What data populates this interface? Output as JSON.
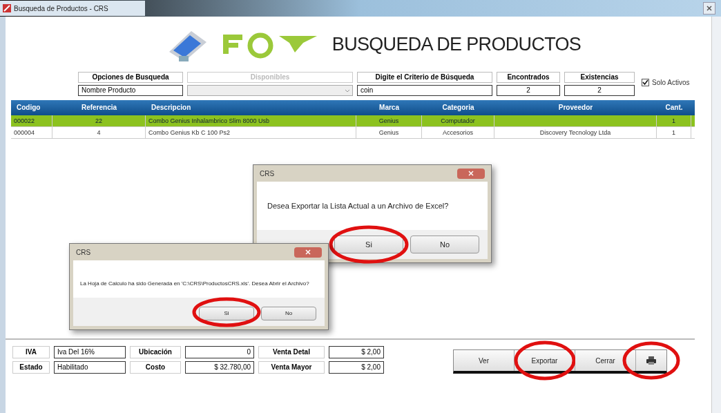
{
  "window": {
    "title": "Busqueda de Productos - CRS"
  },
  "header": {
    "title": "BUSQUEDA DE PRODUCTOS"
  },
  "search": {
    "options_label": "Opciones de Busqueda",
    "option_value": "Nombre Producto",
    "available_label": "Disponibles",
    "criteria_label": "Digite el Criterio de Búsqueda",
    "criteria_value": "coin",
    "found_label": "Encontrados",
    "found_value": "2",
    "stock_label": "Existencias",
    "stock_value": "2",
    "only_active": {
      "label": "Solo Activos",
      "checked": true
    }
  },
  "table": {
    "columns": [
      "Codigo",
      "Referencia",
      "Descripcion",
      "Marca",
      "Categoria",
      "Proveedor",
      "Cant."
    ],
    "rows": [
      {
        "selected": true,
        "cells": [
          "000022",
          "22",
          "Combo Genius Inhalambrico Slim 8000 Usb",
          "Genius",
          "Computador",
          "",
          "1"
        ]
      },
      {
        "selected": false,
        "cells": [
          "000004",
          "4",
          "Combo Genius Kb C 100 Ps2",
          "Genius",
          "Accesorios",
          "Discovery Tecnology Ltda",
          "1"
        ]
      }
    ]
  },
  "dialogs": [
    {
      "title": "CRS",
      "message": "Desea Exportar la Lista Actual a un Archivo de Excel?",
      "buttons": [
        {
          "label": "Si",
          "circled": true
        },
        {
          "label": "No",
          "circled": false
        }
      ]
    },
    {
      "title": "CRS",
      "message": "La Hoja de Calculo ha sido Generada en 'C:\\CRS\\ProductosCRS.xls'. Desea Abrir el Archivo?",
      "buttons": [
        {
          "label": "Si",
          "circled": true
        },
        {
          "label": "No",
          "circled": false
        }
      ]
    }
  ],
  "footer": {
    "fields": [
      {
        "label": "IVA",
        "value": "Iva Del 16%",
        "kind": "text"
      },
      {
        "label": "Ubicación",
        "value": "0",
        "kind": "number"
      },
      {
        "label": "Venta Detal",
        "value": "$ 2,00",
        "kind": "number"
      },
      {
        "label": "Estado",
        "value": "Habilitado",
        "kind": "text"
      },
      {
        "label": "Costo",
        "value": "$ 32.780,00",
        "kind": "number"
      },
      {
        "label": "Venta Mayor",
        "value": "$ 2,00",
        "kind": "number"
      }
    ]
  },
  "buttons": [
    {
      "kind": "text",
      "label": "Ver",
      "circled": false
    },
    {
      "kind": "text",
      "label": "Exportar",
      "circled": true
    },
    {
      "kind": "text",
      "label": "Cerrar",
      "circled": false
    },
    {
      "kind": "print",
      "circled": true
    }
  ]
}
